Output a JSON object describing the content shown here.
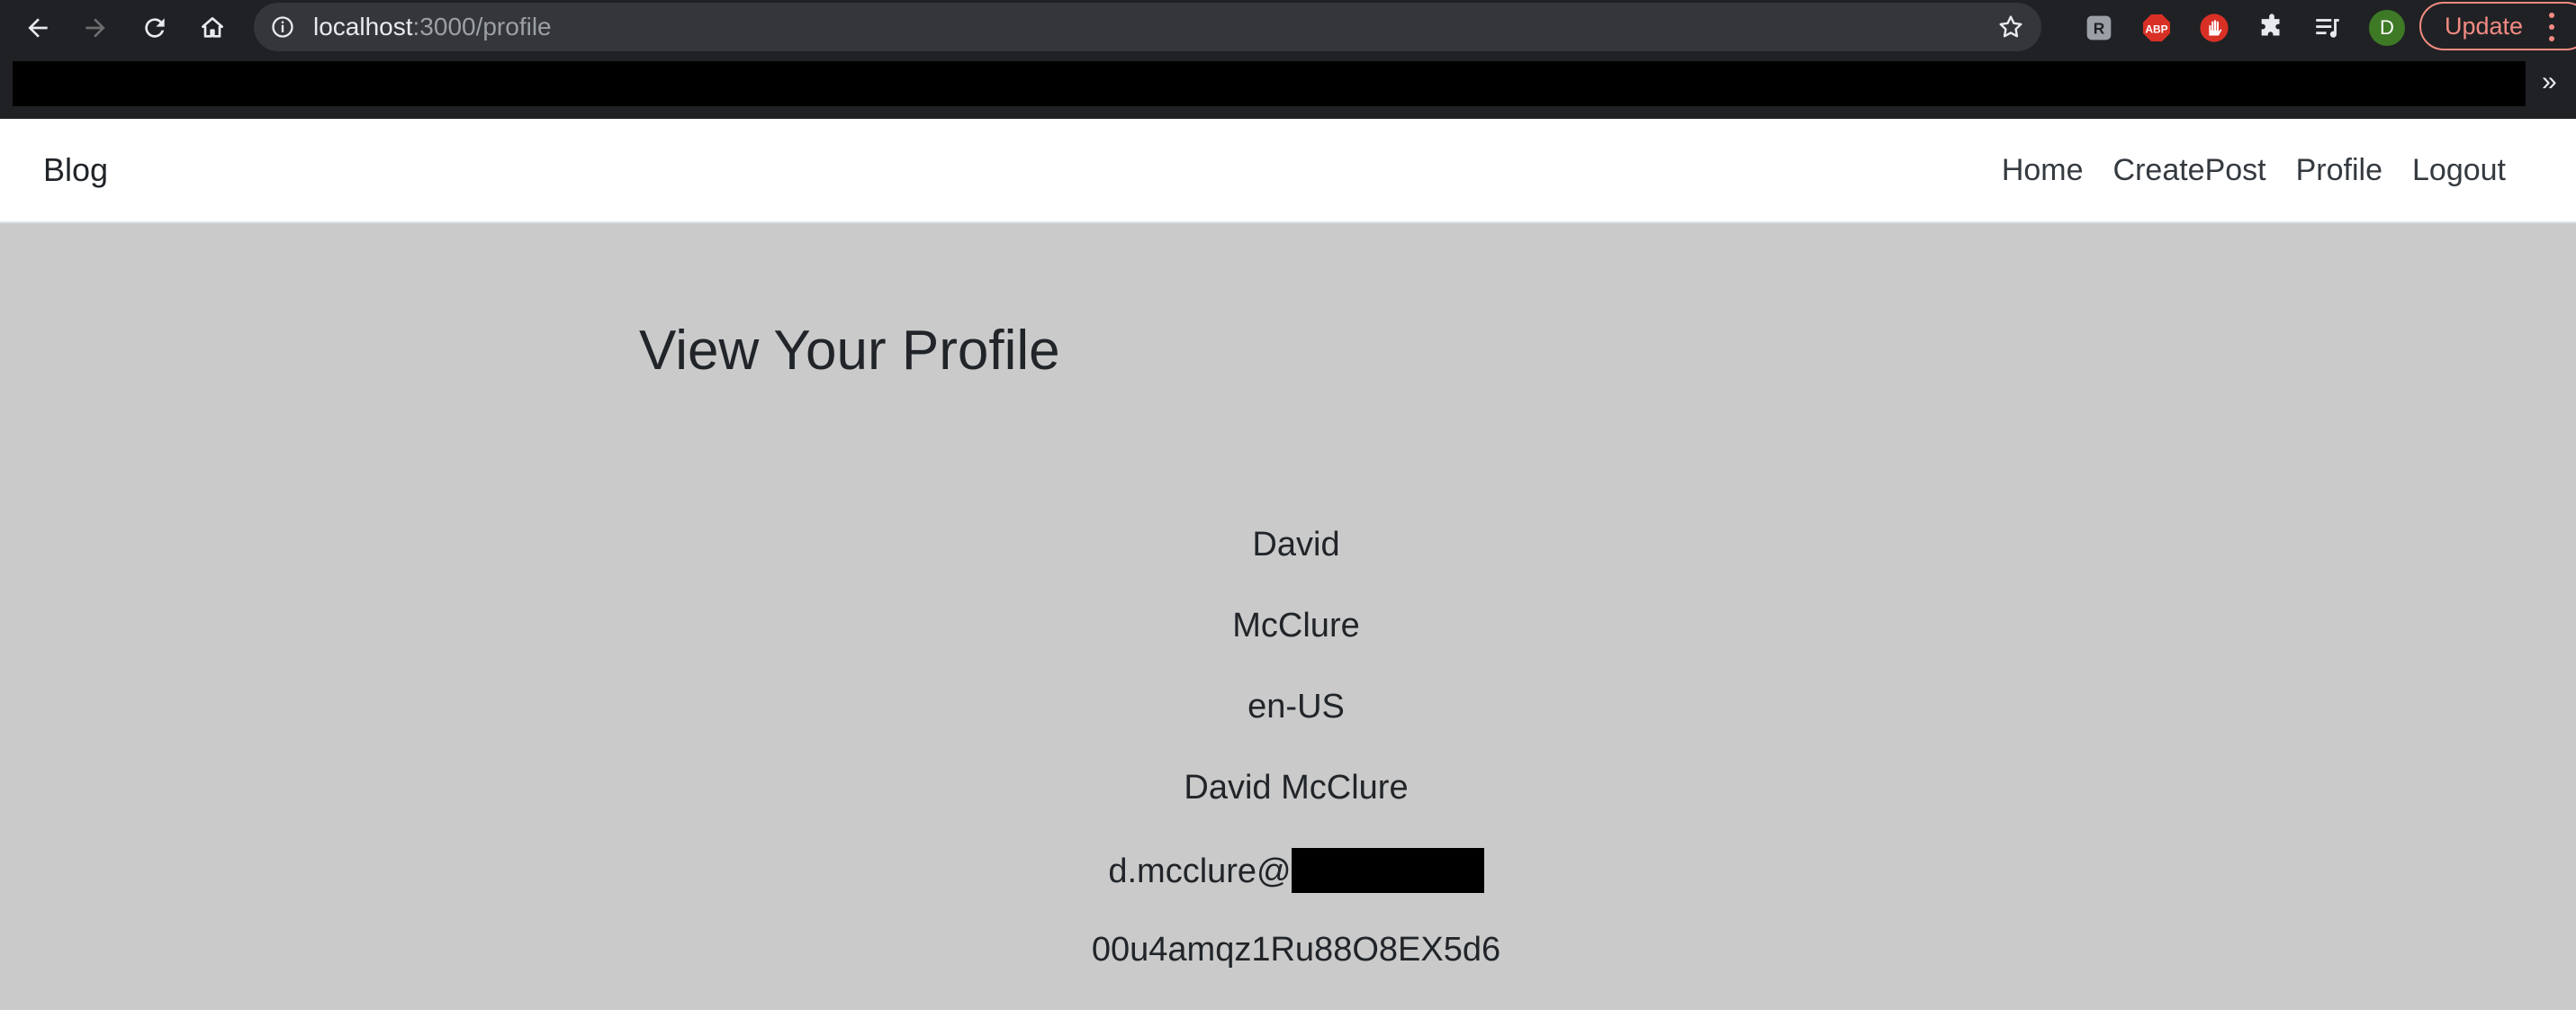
{
  "browser": {
    "url_host": "localhost",
    "url_path": ":3000/profile",
    "avatar_initial": "D",
    "update_label": "Update",
    "bookmarks_overflow": "»",
    "icons": [
      "back-icon",
      "forward-icon",
      "reload-icon",
      "home-icon",
      "info-icon",
      "star-icon",
      "extension-icon",
      "adblock-icon",
      "hand-icon",
      "puzzle-icon",
      "media-queue-icon",
      "menu-dots-icon"
    ]
  },
  "site": {
    "brand": "Blog",
    "nav": [
      {
        "label": "Home"
      },
      {
        "label": "CreatePost"
      },
      {
        "label": "Profile"
      },
      {
        "label": "Logout"
      }
    ]
  },
  "profile": {
    "title": "View Your Profile",
    "given_name": "David",
    "family_name": "McClure",
    "locale": "en-US",
    "full_name": "David McClure",
    "email_visible": "d.mcclure@",
    "id": "00u4amqz1Ru88O8EX5d6"
  },
  "colors": {
    "page_bg": "#cacaca",
    "chrome_bg": "#202124",
    "update_accent": "#f28b82",
    "avatar_bg": "#3e7a26"
  }
}
